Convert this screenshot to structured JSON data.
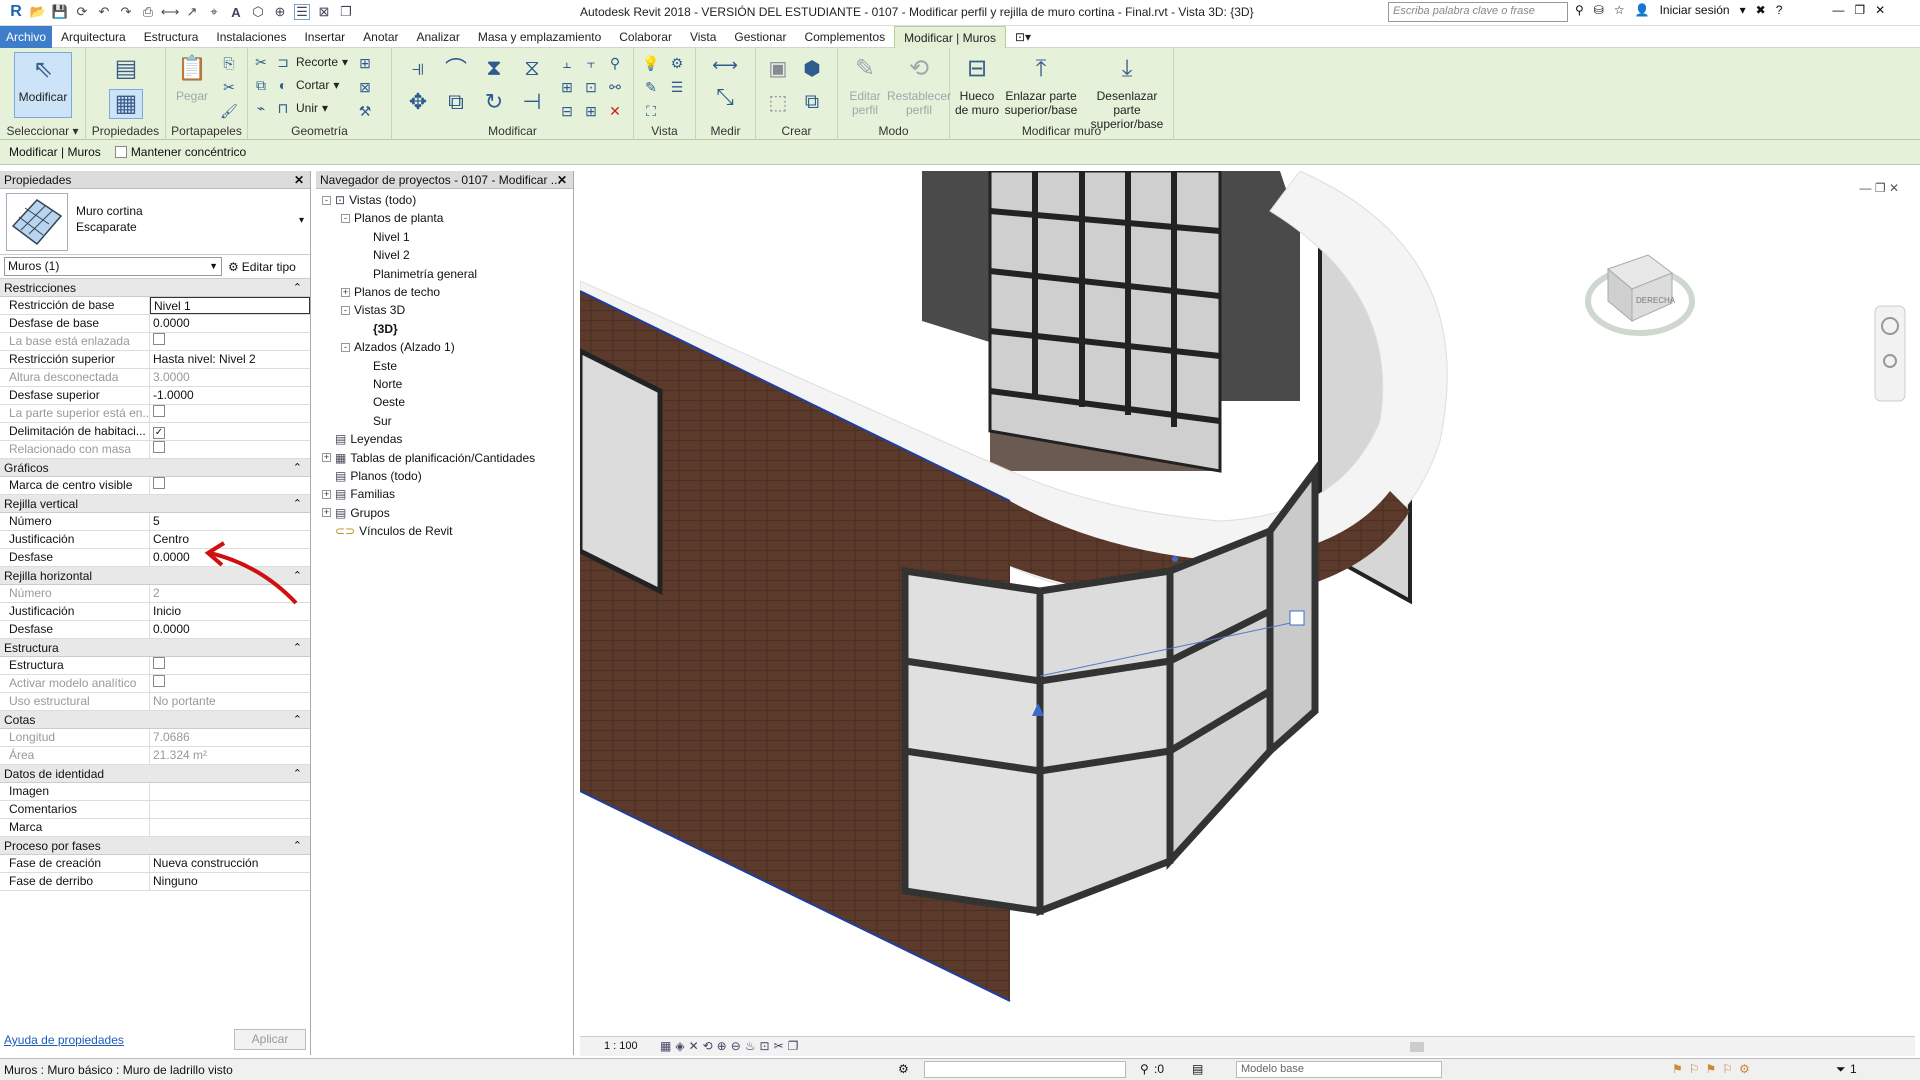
{
  "titlebar": {
    "title": "Autodesk Revit 2018 - VERSIÓN DEL ESTUDIANTE -     0107 - Modificar perfil y rejilla de muro cortina - Final.rvt - Vista 3D: {3D}",
    "search_placeholder": "Escriba palabra clave o frase",
    "signin": "Iniciar sesión"
  },
  "menu": [
    "Archivo",
    "Arquitectura",
    "Estructura",
    "Instalaciones",
    "Insertar",
    "Anotar",
    "Analizar",
    "Masa y emplazamiento",
    "Colaborar",
    "Vista",
    "Gestionar",
    "Complementos",
    "Modificar | Muros"
  ],
  "ribbon": {
    "modify": "Modificar",
    "select": "Seleccionar",
    "properties": "Propiedades",
    "paste": "Pegar",
    "clipboard": "Portapapeles",
    "cut_label": "Recorte",
    "cut2_label": "Cortar",
    "join_label": "Unir",
    "geometry": "Geometría",
    "modify_panel": "Modificar",
    "view_panel": "Vista",
    "measure_panel": "Medir",
    "create_panel": "Crear",
    "edit_profile": "Editar perfil",
    "reset_profile": "Restablecer perfil",
    "mode_panel": "Modo",
    "wall_opening": "Hueco de muro",
    "attach": "Enlazar parte superior/base",
    "detach": "Desenlazar parte superior/base",
    "modify_wall_panel": "Modificar muro"
  },
  "context": {
    "label": "Modificar | Muros",
    "concentric": "Mantener concéntrico"
  },
  "properties": {
    "header": "Propiedades",
    "type_name": "Muro cortina",
    "type_sub": "Escaparate",
    "selector": "Muros (1)",
    "edit_type": "Editar tipo",
    "groups": [
      {
        "name": "Restricciones",
        "rows": [
          {
            "k": "Restricción de base",
            "v": "Nivel 1",
            "dis": false
          },
          {
            "k": "Desfase de base",
            "v": "0.0000",
            "dis": false
          },
          {
            "k": "La base está enlazada",
            "v": "",
            "dis": true,
            "chk": false
          },
          {
            "k": "Restricción superior",
            "v": "Hasta nivel: Nivel 2",
            "dis": false
          },
          {
            "k": "Altura desconectada",
            "v": "3.0000",
            "dis": true
          },
          {
            "k": "Desfase superior",
            "v": "-1.0000",
            "dis": false
          },
          {
            "k": "La parte superior está en...",
            "v": "",
            "dis": true,
            "chk": false
          },
          {
            "k": "Delimitación de habitaci...",
            "v": "",
            "dis": false,
            "chk": true
          },
          {
            "k": "Relacionado con masa",
            "v": "",
            "dis": true,
            "chk": false
          }
        ]
      },
      {
        "name": "Gráficos",
        "rows": [
          {
            "k": "Marca de centro visible",
            "v": "",
            "dis": false,
            "chk": false
          }
        ]
      },
      {
        "name": "Rejilla vertical",
        "rows": [
          {
            "k": "Número",
            "v": "5",
            "dis": false
          },
          {
            "k": "Justificación",
            "v": "Centro",
            "dis": false
          },
          {
            "k": "Desfase",
            "v": "0.0000",
            "dis": false
          }
        ]
      },
      {
        "name": "Rejilla horizontal",
        "rows": [
          {
            "k": "Número",
            "v": "2",
            "dis": true
          },
          {
            "k": "Justificación",
            "v": "Inicio",
            "dis": false
          },
          {
            "k": "Desfase",
            "v": "0.0000",
            "dis": false
          }
        ]
      },
      {
        "name": "Estructura",
        "rows": [
          {
            "k": "Estructura",
            "v": "",
            "dis": false,
            "chk": false
          },
          {
            "k": "Activar modelo analítico",
            "v": "",
            "dis": true,
            "chk": false
          },
          {
            "k": "Uso estructural",
            "v": "No portante",
            "dis": true
          }
        ]
      },
      {
        "name": "Cotas",
        "rows": [
          {
            "k": "Longitud",
            "v": "7.0686",
            "dis": true
          },
          {
            "k": "Área",
            "v": "21.324 m²",
            "dis": true
          }
        ]
      },
      {
        "name": "Datos de identidad",
        "rows": [
          {
            "k": "Imagen",
            "v": "",
            "dis": false
          },
          {
            "k": "Comentarios",
            "v": "",
            "dis": false
          },
          {
            "k": "Marca",
            "v": "",
            "dis": false
          }
        ]
      },
      {
        "name": "Proceso por fases",
        "rows": [
          {
            "k": "Fase de creación",
            "v": "Nueva construcción",
            "dis": false
          },
          {
            "k": "Fase de derribo",
            "v": "Ninguno",
            "dis": false
          }
        ]
      }
    ],
    "help": "Ayuda de propiedades",
    "apply": "Aplicar"
  },
  "browser": {
    "header": "Navegador de proyectos - 0107 - Modificar ...",
    "items": [
      {
        "label": "Vistas (todo)"
      },
      {
        "label": "Planos de planta"
      },
      {
        "label": "Nivel 1"
      },
      {
        "label": "Nivel 2"
      },
      {
        "label": "Planimetría general"
      },
      {
        "label": "Planos de techo"
      },
      {
        "label": "Vistas 3D"
      },
      {
        "label": "{3D}"
      },
      {
        "label": "Alzados (Alzado 1)"
      },
      {
        "label": "Este"
      },
      {
        "label": "Norte"
      },
      {
        "label": "Oeste"
      },
      {
        "label": "Sur"
      },
      {
        "label": "Leyendas"
      },
      {
        "label": "Tablas de planificación/Cantidades"
      },
      {
        "label": "Planos (todo)"
      },
      {
        "label": "Familias"
      },
      {
        "label": "Grupos"
      },
      {
        "label": "Vínculos de Revit"
      }
    ]
  },
  "viewcube": {
    "face": "DERECHA"
  },
  "viewbar": {
    "scale": "1 : 100"
  },
  "status": {
    "text": "Muros : Muro básico : Muro de ladrillo visto",
    "model": "Modelo base",
    "sel_count": ":0",
    "filter": "1"
  },
  "colors": {
    "ribbon": "#e6f1da",
    "accent": "#3d7dc9",
    "brick": "#5a3a2c",
    "selection": "#1f3fa0",
    "arrow": "#d01010"
  }
}
